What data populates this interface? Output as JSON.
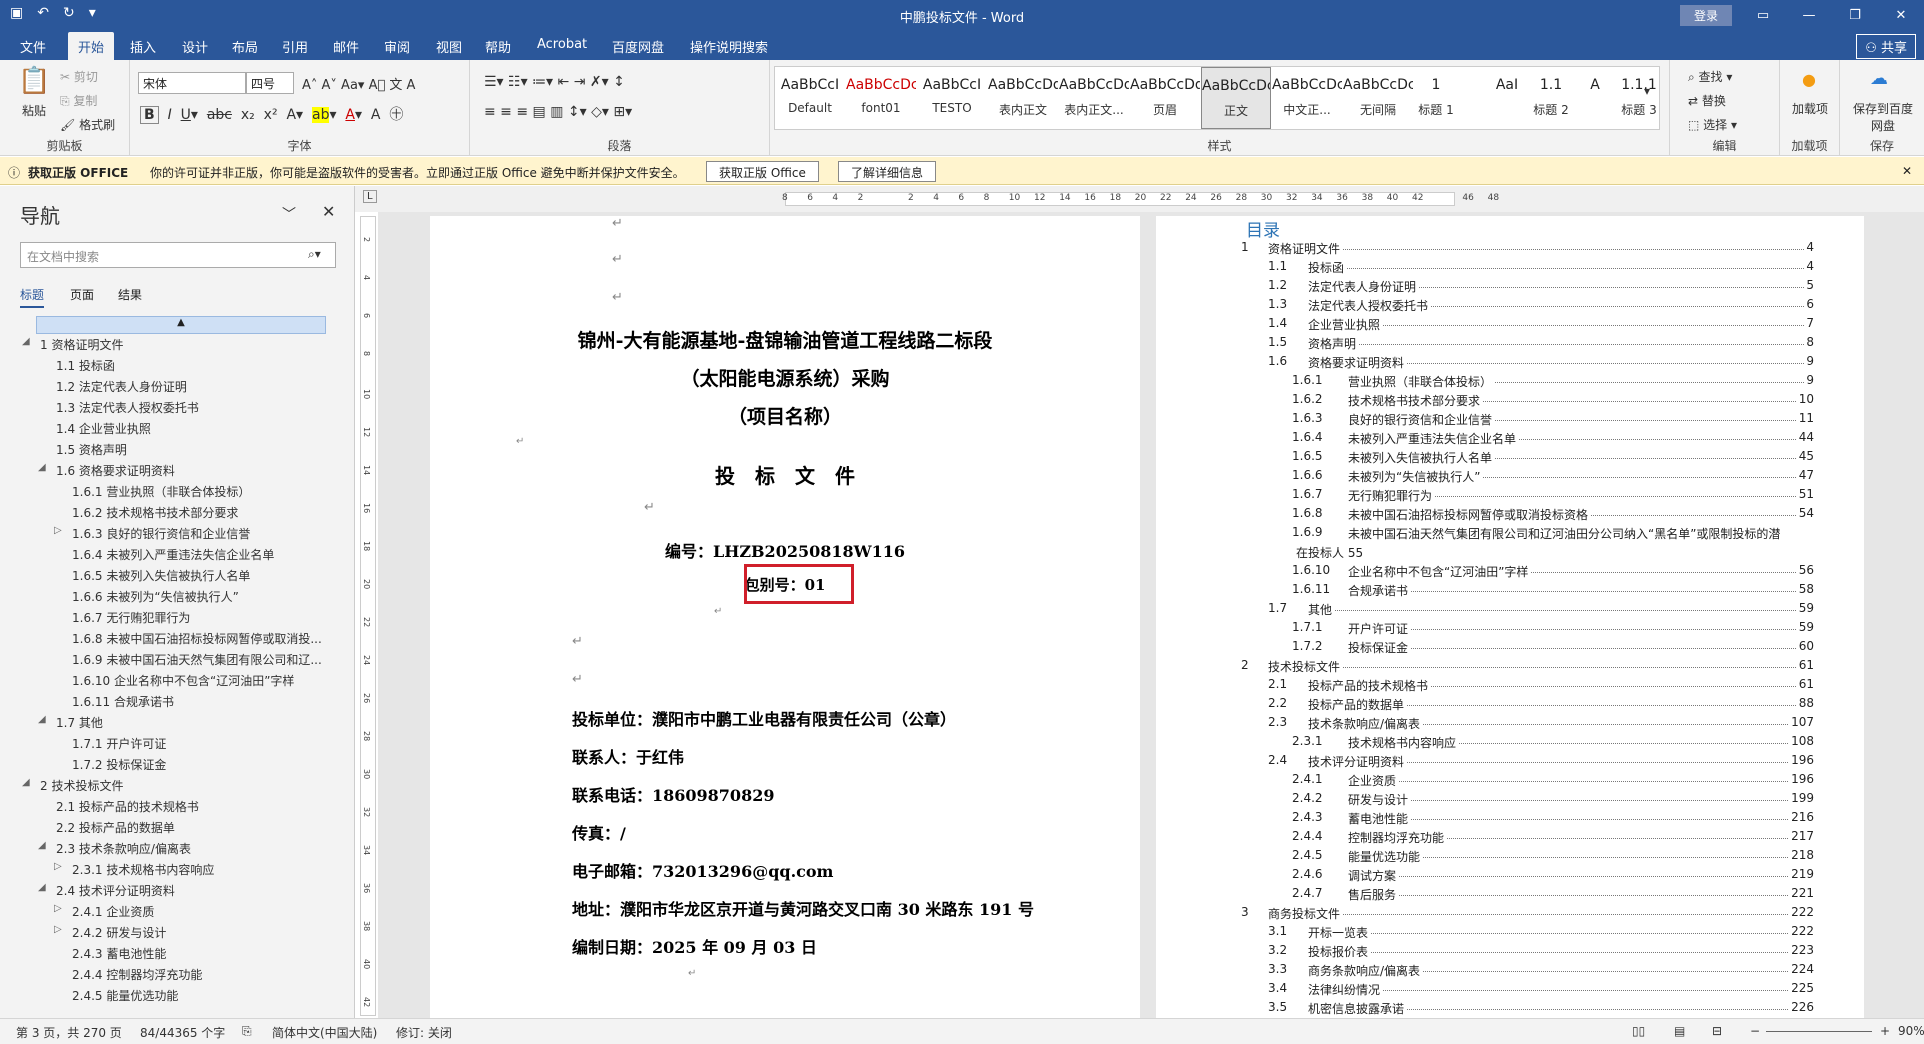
{
  "window": {
    "title": "中鹏投标文件 - Word",
    "login": "登录"
  },
  "ribbon_tabs": [
    "文件",
    "开始",
    "插入",
    "设计",
    "布局",
    "引用",
    "邮件",
    "审阅",
    "视图",
    "帮助",
    "Acrobat",
    "百度网盘",
    "操作说明搜索"
  ],
  "share": "共享",
  "clipboard": {
    "paste": "粘贴",
    "cut": "剪切",
    "copy": "复制",
    "format": "格式刷",
    "label": "剪贴板"
  },
  "font": {
    "name": "宋体",
    "size": "四号",
    "label": "字体"
  },
  "paragraph": {
    "label": "段落"
  },
  "styles": {
    "label": "样式",
    "items": [
      {
        "pv": "AaBbCcI",
        "nm": "Default"
      },
      {
        "pv": "AaBbCcDc",
        "nm": "font01"
      },
      {
        "pv": "AaBbCcI",
        "nm": "TESTO"
      },
      {
        "pv": "AaBbCcDdI",
        "nm": "表内正文"
      },
      {
        "pv": "AaBbCcDdI",
        "nm": "表内正文..."
      },
      {
        "pv": "AaBbCcDdE",
        "nm": "页眉"
      },
      {
        "pv": "AaBbCcDc",
        "nm": "正文"
      },
      {
        "pv": "AaBbCcDc",
        "nm": "中文正..."
      },
      {
        "pv": "AaBbCcDc",
        "nm": "无间隔"
      },
      {
        "pv": "1",
        "nm": "标题 1"
      },
      {
        "pv": "AaI",
        "nm": ""
      },
      {
        "pv": "1.1",
        "nm": "标题 2"
      },
      {
        "pv": "A",
        "nm": ""
      },
      {
        "pv": "1.1.1",
        "nm": "标题 3"
      }
    ]
  },
  "editing": {
    "find": "查找",
    "replace": "替换",
    "select": "选择",
    "label": "编辑"
  },
  "addin": {
    "btn": "加载项",
    "label": "加载项"
  },
  "save": {
    "btn": "保存到百度网盘",
    "label": "保存"
  },
  "msgbar": {
    "title": "获取正版 OFFICE",
    "text": "你的许可证并非正版，你可能是盗版软件的受害者。立即通过正版 Office 避免中断并保护文件安全。",
    "btn1": "获取正版 Office",
    "btn2": "了解详细信息"
  },
  "nav": {
    "title": "导航",
    "search_placeholder": "在文档中搜索",
    "tabs": [
      "标题",
      "页面",
      "结果"
    ],
    "items": [
      {
        "t": "1 资格证明文件",
        "lv": 0,
        "ar": "◢"
      },
      {
        "t": "1.1 投标函",
        "lv": 1
      },
      {
        "t": "1.2 法定代表人身份证明",
        "lv": 1
      },
      {
        "t": "1.3 法定代表人授权委托书",
        "lv": 1
      },
      {
        "t": "1.4 企业营业执照",
        "lv": 1
      },
      {
        "t": "1.5 资格声明",
        "lv": 1
      },
      {
        "t": "1.6 资格要求证明资料",
        "lv": 1,
        "ar": "◢"
      },
      {
        "t": "1.6.1 营业执照（非联合体投标）",
        "lv": 2
      },
      {
        "t": "1.6.2 技术规格书技术部分要求",
        "lv": 2
      },
      {
        "t": "1.6.3 良好的银行资信和企业信誉",
        "lv": 2,
        "ar": "▷"
      },
      {
        "t": "1.6.4 未被列入严重违法失信企业名单",
        "lv": 2
      },
      {
        "t": "1.6.5 未被列入失信被执行人名单",
        "lv": 2
      },
      {
        "t": "1.6.6 未被列为“失信被执行人”",
        "lv": 2
      },
      {
        "t": "1.6.7 无行贿犯罪行为",
        "lv": 2
      },
      {
        "t": "1.6.8 未被中国石油招标投标网暂停或取消投...",
        "lv": 2
      },
      {
        "t": "1.6.9 未被中国石油天然气集团有限公司和辽...",
        "lv": 2
      },
      {
        "t": "1.6.10 企业名称中不包含“辽河油田”字样",
        "lv": 2
      },
      {
        "t": "1.6.11 合规承诺书",
        "lv": 2
      },
      {
        "t": "1.7 其他",
        "lv": 1,
        "ar": "◢"
      },
      {
        "t": "1.7.1 开户许可证",
        "lv": 2
      },
      {
        "t": "1.7.2 投标保证金",
        "lv": 2
      },
      {
        "t": "2 技术投标文件",
        "lv": 0,
        "ar": "◢"
      },
      {
        "t": "2.1 投标产品的技术规格书",
        "lv": 1
      },
      {
        "t": "2.2 投标产品的数据单",
        "lv": 1
      },
      {
        "t": "2.3 技术条款响应/偏离表",
        "lv": 1,
        "ar": "◢"
      },
      {
        "t": "2.3.1 技术规格书内容响应",
        "lv": 2,
        "ar": "▷"
      },
      {
        "t": "2.4 技术评分证明资料",
        "lv": 1,
        "ar": "◢"
      },
      {
        "t": "2.4.1 企业资质",
        "lv": 2,
        "ar": "▷"
      },
      {
        "t": "2.4.2 研发与设计",
        "lv": 2,
        "ar": "▷"
      },
      {
        "t": "2.4.3 蓄电池性能",
        "lv": 2
      },
      {
        "t": "2.4.4 控制器均浮充功能",
        "lv": 2
      },
      {
        "t": "2.4.5 能量优选功能",
        "lv": 2
      }
    ]
  },
  "ruler": [
    "8",
    "6",
    "4",
    "2",
    "",
    "2",
    "4",
    "6",
    "8",
    "10",
    "12",
    "14",
    "16",
    "18",
    "20",
    "22",
    "24",
    "26",
    "28",
    "30",
    "32",
    "34",
    "36",
    "38",
    "40",
    "42",
    "",
    "46",
    "48"
  ],
  "vruler": [
    "2",
    "4",
    "6",
    "8",
    "10",
    "12",
    "14",
    "16",
    "18",
    "20",
    "22",
    "24",
    "26",
    "28",
    "30",
    "32",
    "34",
    "36",
    "38",
    "40",
    "42"
  ],
  "cover": {
    "title1": "锦州-大有能源基地-盘锦输油管道工程线路二标段",
    "title2": "（太阳能电源系统）采购",
    "title3": "（项目名称）",
    "doctype": "投　标　文　件",
    "code": "编号：LHZB20250818W116",
    "pkg": "包别号：01",
    "bidder": "投标单位：濮阳市中鹏工业电器有限责任公司（公章）",
    "contact": "联系人：于红伟",
    "phone": "联系电话：18609870829",
    "fax": "传真：/",
    "email": "电子邮箱：732013296@qq.com",
    "address": "地址：濮阳市华龙区京开道与黄河路交叉口南 30 米路东 191 号",
    "date": "编制日期：2025 年 09 月 03 日"
  },
  "toc": {
    "title": "目录",
    "entries": [
      {
        "n": "1",
        "t": "资格证明文件",
        "p": "4",
        "lv": 0
      },
      {
        "n": "1.1",
        "t": "投标函",
        "p": "4",
        "lv": 1
      },
      {
        "n": "1.2",
        "t": "法定代表人身份证明",
        "p": "5",
        "lv": 1
      },
      {
        "n": "1.3",
        "t": "法定代表人授权委托书",
        "p": "6",
        "lv": 1
      },
      {
        "n": "1.4",
        "t": "企业营业执照",
        "p": "7",
        "lv": 1
      },
      {
        "n": "1.5",
        "t": "资格声明",
        "p": "8",
        "lv": 1
      },
      {
        "n": "1.6",
        "t": "资格要求证明资料",
        "p": "9",
        "lv": 1
      },
      {
        "n": "1.6.1",
        "t": "营业执照（非联合体投标）",
        "p": "9",
        "lv": 2
      },
      {
        "n": "1.6.2",
        "t": "技术规格书技术部分要求",
        "p": "10",
        "lv": 2
      },
      {
        "n": "1.6.3",
        "t": "良好的银行资信和企业信誉",
        "p": "11",
        "lv": 2
      },
      {
        "n": "1.6.4",
        "t": "未被列入严重违法失信企业名单",
        "p": "44",
        "lv": 2
      },
      {
        "n": "1.6.5",
        "t": "未被列入失信被执行人名单",
        "p": "45",
        "lv": 2
      },
      {
        "n": "1.6.6",
        "t": "未被列为“失信被执行人”",
        "p": "47",
        "lv": 2
      },
      {
        "n": "1.6.7",
        "t": "无行贿犯罪行为",
        "p": "51",
        "lv": 2
      },
      {
        "n": "1.6.8",
        "t": "未被中国石油招标投标网暂停或取消投标资格",
        "p": "54",
        "lv": 2
      },
      {
        "n": "1.6.9",
        "t": "未被中国石油天然气集团有限公司和辽河油田分公司纳入“黑名单”或限制投标的潜",
        "p": "",
        "lv": 2,
        "cont": "在投标人 55"
      },
      {
        "n": "1.6.10",
        "t": "企业名称中不包含“辽河油田”字样",
        "p": "56",
        "lv": 2
      },
      {
        "n": "1.6.11",
        "t": "合规承诺书",
        "p": "58",
        "lv": 2
      },
      {
        "n": "1.7",
        "t": "其他",
        "p": "59",
        "lv": 1
      },
      {
        "n": "1.7.1",
        "t": "开户许可证",
        "p": "59",
        "lv": 2
      },
      {
        "n": "1.7.2",
        "t": "投标保证金",
        "p": "60",
        "lv": 2
      },
      {
        "n": "2",
        "t": "技术投标文件",
        "p": "61",
        "lv": 0
      },
      {
        "n": "2.1",
        "t": "投标产品的技术规格书",
        "p": "61",
        "lv": 1
      },
      {
        "n": "2.2",
        "t": "投标产品的数据单",
        "p": "88",
        "lv": 1
      },
      {
        "n": "2.3",
        "t": "技术条款响应/偏离表",
        "p": "107",
        "lv": 1
      },
      {
        "n": "2.3.1",
        "t": "技术规格书内容响应",
        "p": "108",
        "lv": 2
      },
      {
        "n": "2.4",
        "t": "技术评分证明资料",
        "p": "196",
        "lv": 1
      },
      {
        "n": "2.4.1",
        "t": "企业资质",
        "p": "196",
        "lv": 2
      },
      {
        "n": "2.4.2",
        "t": "研发与设计",
        "p": "199",
        "lv": 2
      },
      {
        "n": "2.4.3",
        "t": "蓄电池性能",
        "p": "216",
        "lv": 2
      },
      {
        "n": "2.4.4",
        "t": "控制器均浮充功能",
        "p": "217",
        "lv": 2
      },
      {
        "n": "2.4.5",
        "t": "能量优选功能",
        "p": "218",
        "lv": 2
      },
      {
        "n": "2.4.6",
        "t": "调试方案",
        "p": "219",
        "lv": 2
      },
      {
        "n": "2.4.7",
        "t": "售后服务",
        "p": "221",
        "lv": 2
      },
      {
        "n": "3",
        "t": "商务投标文件",
        "p": "222",
        "lv": 0
      },
      {
        "n": "3.1",
        "t": "开标一览表",
        "p": "222",
        "lv": 1
      },
      {
        "n": "3.2",
        "t": "投标报价表",
        "p": "223",
        "lv": 1
      },
      {
        "n": "3.3",
        "t": "商务条款响应/偏离表",
        "p": "224",
        "lv": 1
      },
      {
        "n": "3.4",
        "t": "法律纠纷情况",
        "p": "225",
        "lv": 1
      },
      {
        "n": "3.5",
        "t": "机密信息披露承诺",
        "p": "226",
        "lv": 1
      }
    ]
  },
  "status": {
    "page": "第 3 页，共 270 页",
    "words": "84/44365 个字",
    "lang": "简体中文(中国大陆)",
    "track": "修订: 关闭",
    "zoom": "90%"
  }
}
